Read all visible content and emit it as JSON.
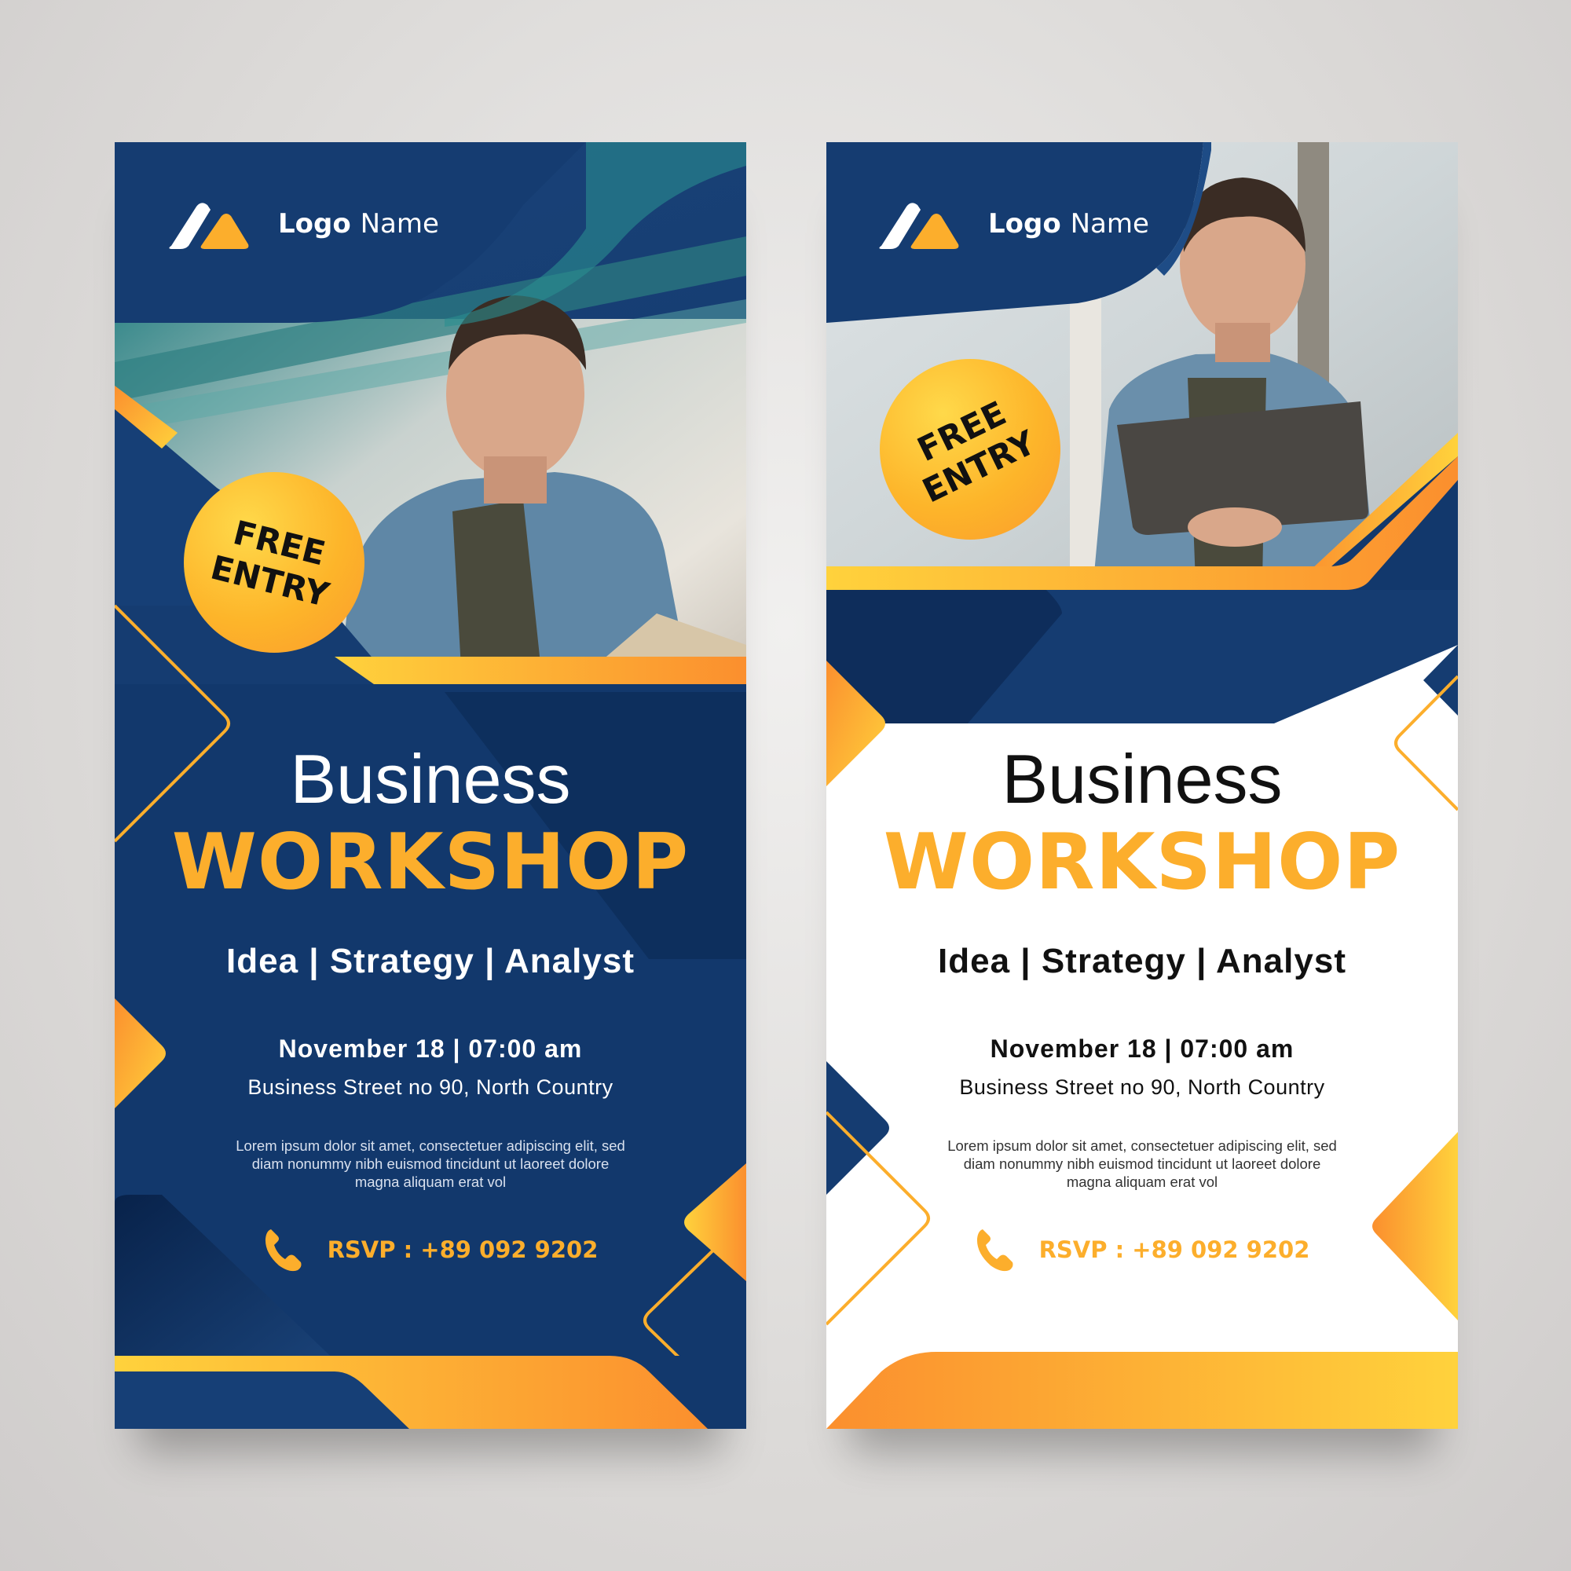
{
  "colors": {
    "navy": "#12386c",
    "orange": "#fcae2c",
    "white": "#ffffff"
  },
  "banner_left": {
    "logo": {
      "bold": "Logo",
      "regular": "Name",
      "icon": "mountain-logo-icon"
    },
    "badge": {
      "line1": "FREE",
      "line2": "ENTRY"
    },
    "title_line1": "Business",
    "title_line2": "WORKSHOP",
    "tags": "Idea | Strategy | Analyst",
    "date_time": "November 18 | 07:00 am",
    "address": "Business Street no 90, North Country",
    "lorem": "Lorem ipsum dolor sit amet, consectetuer adipiscing elit, sed diam nonummy nibh euismod tincidunt ut laoreet dolore magna aliquam erat vol",
    "rsvp": "RSVP : +89 092 9202",
    "rsvp_icon": "phone-icon",
    "photo": "man-holding-tablet-photo"
  },
  "banner_right": {
    "logo": {
      "bold": "Logo",
      "regular": "Name",
      "icon": "mountain-logo-icon"
    },
    "badge": {
      "line1": "FREE",
      "line2": "ENTRY"
    },
    "title_line1": "Business",
    "title_line2": "WORKSHOP",
    "tags": "Idea | Strategy | Analyst",
    "date_time": "November 18 | 07:00 am",
    "address": "Business Street no 90, North Country",
    "lorem": "Lorem ipsum dolor sit amet, consectetuer adipiscing elit, sed diam nonummy nibh euismod tincidunt ut laoreet dolore magna aliquam erat vol",
    "rsvp": "RSVP : +89 092 9202",
    "rsvp_icon": "phone-icon",
    "photo": "man-holding-laptop-photo"
  }
}
